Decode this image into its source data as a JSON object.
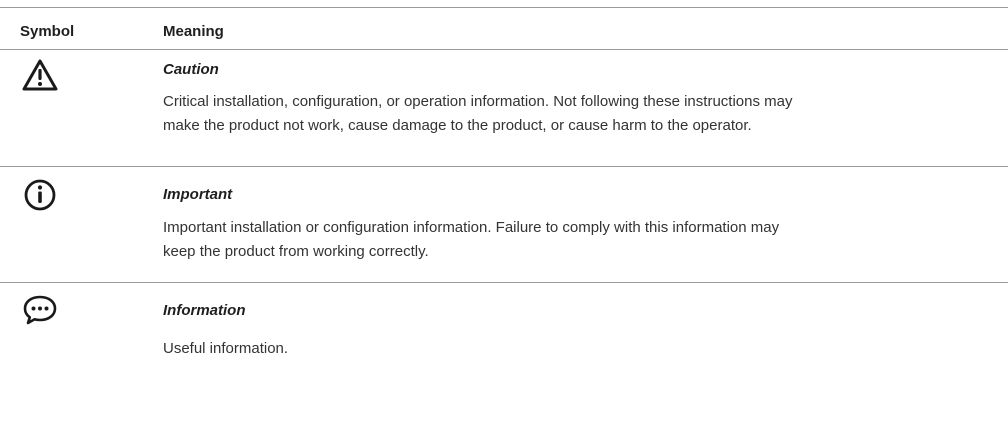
{
  "table": {
    "headers": {
      "symbol": "Symbol",
      "meaning": "Meaning"
    },
    "rows": [
      {
        "icon": "caution-triangle-icon",
        "title": "Caution",
        "description": "Critical installation, configuration, or operation information. Not following these instructions may make the product not work, cause damage to the product, or cause harm to the operator."
      },
      {
        "icon": "info-circle-icon",
        "title": "Important",
        "description": "Important installation or configuration information. Failure to comply with this information may keep the product from working correctly."
      },
      {
        "icon": "speech-bubble-icon",
        "title": "Information",
        "description": "Useful information."
      }
    ]
  }
}
